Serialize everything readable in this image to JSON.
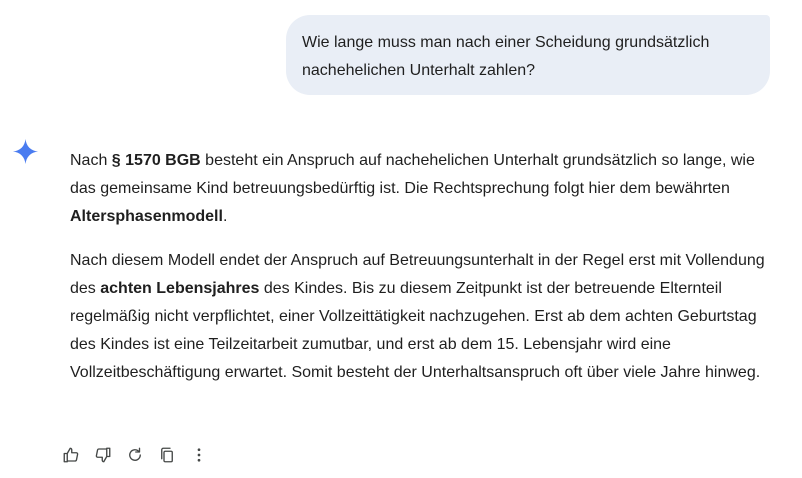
{
  "user_message": {
    "line1": "Wie lange muss man nach einer Scheidung grundsätzlich",
    "line2": "nachehelichen Unterhalt zahlen?"
  },
  "assistant": {
    "icon": "gemini-spark-icon",
    "icon_color": "#4a7cf0",
    "p1": {
      "t1": "Nach ",
      "b1": "§ 1570 BGB",
      "t2": " besteht ein Anspruch auf nachehelichen Unterhalt grundsätzlich so lange, wie das gemeinsame Kind betreuungsbedürftig ist. Die Rechtsprechung folgt hier dem bewährten ",
      "b2": "Altersphasenmodell",
      "t3": "."
    },
    "p2": {
      "t1": "Nach diesem Modell endet der Anspruch auf Betreuungsunterhalt in der Regel erst mit Vollendung des ",
      "b1": "achten Lebensjahres",
      "t2": " des Kindes. Bis zu diesem Zeitpunkt ist der betreuende Elternteil regelmäßig nicht verpflichtet, einer Vollzeittätigkeit nachzugehen. Erst ab dem achten Geburtstag des Kindes ist eine Teilzeitarbeit zumutbar, und erst ab dem 15. Lebensjahr wird eine Vollzeitbeschäftigung erwartet. Somit besteht der Unterhaltsanspruch oft über viele Jahre hinweg."
    }
  },
  "actions": {
    "thumbs_up": "thumbs-up-icon",
    "thumbs_down": "thumbs-down-icon",
    "regenerate": "refresh-icon",
    "copy": "copy-icon",
    "more": "more-vert-icon"
  },
  "colors": {
    "bubble_bg": "#e9eef6",
    "text": "#1f1f1f",
    "icon": "#444746"
  }
}
